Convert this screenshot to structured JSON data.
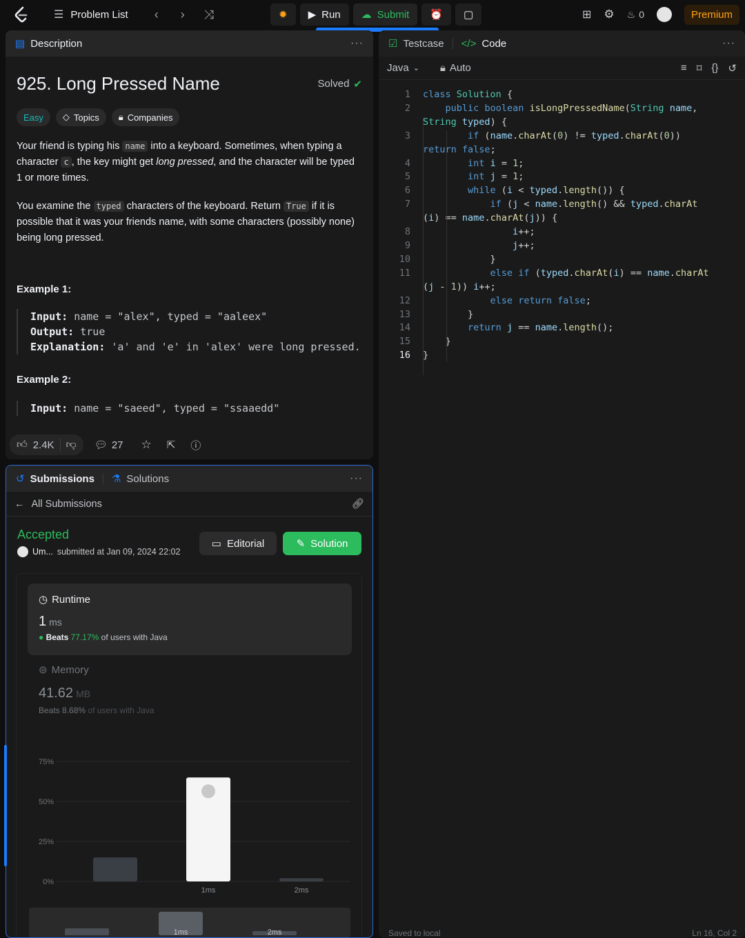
{
  "topbar": {
    "problem_list": "Problem List",
    "run": "Run",
    "submit": "Submit",
    "streak": "0",
    "premium": "Premium"
  },
  "description": {
    "tab": "Description",
    "title": "925. Long Pressed Name",
    "status": "Solved",
    "chips": {
      "difficulty": "Easy",
      "topics": "Topics",
      "companies": "Companies"
    },
    "para1": {
      "a": "Your friend is typing his ",
      "code1": "name",
      "b": " into a keyboard. Sometimes, when typing a character ",
      "code2": "c",
      "c": ", the key might get ",
      "em": "long pressed",
      "d": ", and the character will be typed 1 or more times."
    },
    "para2": {
      "a": "You examine the ",
      "code1": "typed",
      "b": " characters of the keyboard. Return ",
      "code2": "True",
      "c": " if it is possible that it was your friends name, with some characters (possibly none) being long pressed."
    },
    "example1": {
      "title": "Example 1:",
      "input_label": "Input:",
      "input": " name = \"alex\", typed = \"aaleex\"",
      "output_label": "Output:",
      "output": " true",
      "expl_label": "Explanation:",
      "expl": " 'a' and 'e' in 'alex' were long pressed."
    },
    "example2": {
      "title": "Example 2:",
      "input_label": "Input:",
      "input": " name = \"saeed\", typed = \"ssaaedd\""
    },
    "footer": {
      "likes": "2.4K",
      "comments": "27"
    }
  },
  "submissions": {
    "tab_submissions": "Submissions",
    "tab_solutions": "Solutions",
    "back_label": "All Submissions",
    "status": "Accepted",
    "user": "Um...",
    "submitted": "submitted at Jan 09, 2024 22:02",
    "editorial": "Editorial",
    "solution": "Solution",
    "runtime": {
      "title": "Runtime",
      "value": "1",
      "unit": "ms",
      "beats_label": "Beats",
      "beats_pct": "77.17%",
      "beats_suffix": "of users with Java"
    },
    "memory": {
      "title": "Memory",
      "value": "41.62",
      "unit": "MB",
      "beats_label": "Beats",
      "beats_pct": "8.68%",
      "beats_suffix": "of users with Java"
    }
  },
  "chart_data": {
    "type": "bar",
    "categories": [
      "",
      "1ms",
      "2ms"
    ],
    "values": [
      15,
      65,
      2
    ],
    "highlight_index": 1,
    "yticks": [
      "75%",
      "50%",
      "25%",
      "0%"
    ],
    "ylim": [
      0,
      75
    ],
    "mini_labels": [
      "1ms",
      "2ms"
    ]
  },
  "code": {
    "tab_testcase": "Testcase",
    "tab_code": "Code",
    "language": "Java",
    "mode": "Auto",
    "status_left": "Saved to local",
    "status_right": "Ln 16, Col 2"
  }
}
